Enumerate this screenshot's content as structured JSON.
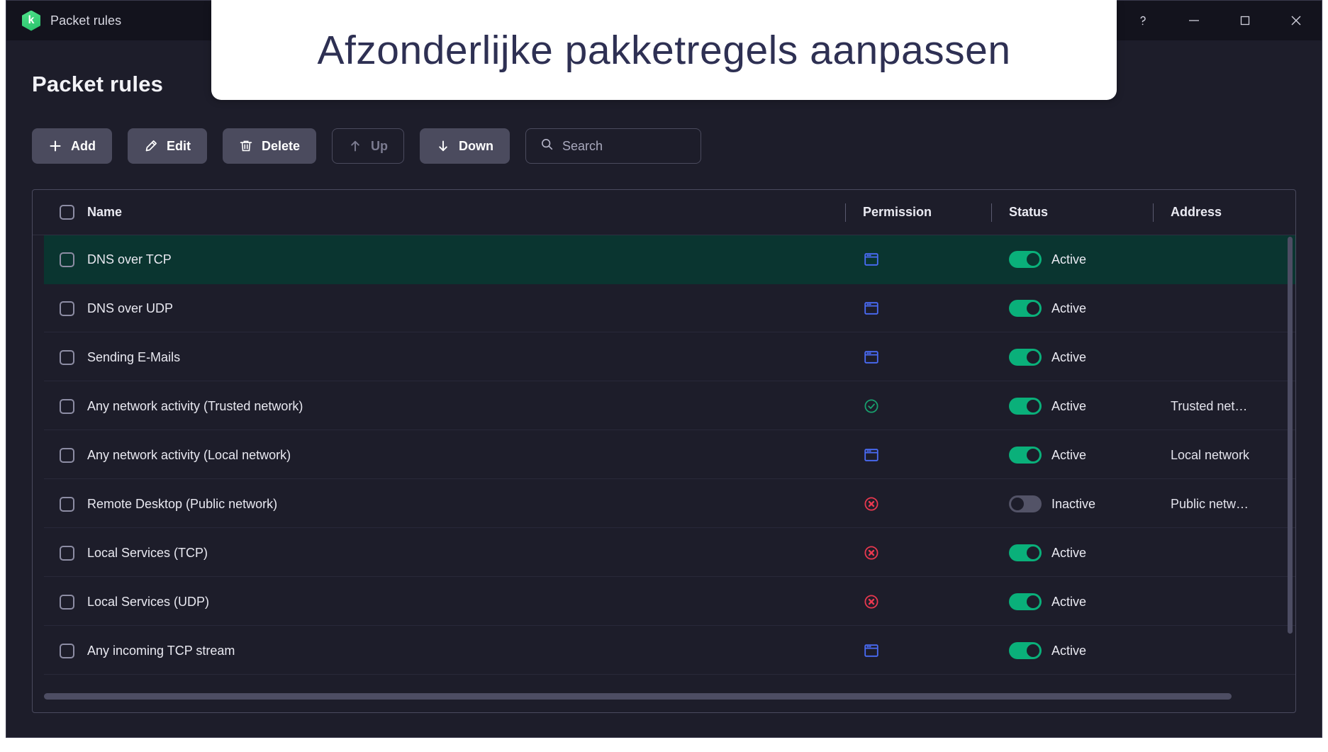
{
  "window": {
    "title": "Packet rules",
    "logo_icon": "kaspersky-hex-k-icon",
    "logo_letter": "k",
    "controls": [
      {
        "name": "help-button",
        "icon": "question-mark-icon",
        "label": "?"
      },
      {
        "name": "minimize-button",
        "icon": "minimize-icon",
        "label": "—"
      },
      {
        "name": "maximize-button",
        "icon": "maximize-icon",
        "label": "□"
      },
      {
        "name": "close-button",
        "icon": "close-icon",
        "label": "×"
      }
    ]
  },
  "page": {
    "title": "Packet rules"
  },
  "overlay": {
    "text": "Afzonderlijke pakketregels aanpassen",
    "text_color": "#2e3053",
    "background": "#ffffff"
  },
  "toolbar": {
    "add_label": "Add",
    "add_icon": "plus-icon",
    "edit_label": "Edit",
    "edit_icon": "pencil-icon",
    "delete_label": "Delete",
    "delete_icon": "trash-icon",
    "up_label": "Up",
    "up_icon": "arrow-up-icon",
    "up_disabled": true,
    "down_label": "Down",
    "down_icon": "arrow-down-icon",
    "down_disabled": false,
    "search_placeholder": "Search",
    "search_value": "",
    "search_icon": "magnifier-icon"
  },
  "table": {
    "columns": {
      "name": "Name",
      "permission": "Permission",
      "status": "Status",
      "address": "Address"
    },
    "select_all_checked": false,
    "rows": [
      {
        "name": "DNS over TCP",
        "permission": "ask",
        "status": "Active",
        "status_on": true,
        "address": "",
        "selected": true,
        "checked": false
      },
      {
        "name": "DNS over UDP",
        "permission": "ask",
        "status": "Active",
        "status_on": true,
        "address": "",
        "selected": false,
        "checked": false
      },
      {
        "name": "Sending E-Mails",
        "permission": "ask",
        "status": "Active",
        "status_on": true,
        "address": "",
        "selected": false,
        "checked": false
      },
      {
        "name": "Any network activity (Trusted network)",
        "permission": "allow",
        "status": "Active",
        "status_on": true,
        "address": "Trusted net…",
        "selected": false,
        "checked": false
      },
      {
        "name": "Any network activity (Local network)",
        "permission": "ask",
        "status": "Active",
        "status_on": true,
        "address": "Local network",
        "selected": false,
        "checked": false
      },
      {
        "name": "Remote Desktop (Public network)",
        "permission": "block",
        "status": "Inactive",
        "status_on": false,
        "address": "Public netw…",
        "selected": false,
        "checked": false
      },
      {
        "name": "Local Services (TCP)",
        "permission": "block",
        "status": "Active",
        "status_on": true,
        "address": "",
        "selected": false,
        "checked": false
      },
      {
        "name": "Local Services (UDP)",
        "permission": "block",
        "status": "Active",
        "status_on": true,
        "address": "",
        "selected": false,
        "checked": false
      },
      {
        "name": "Any incoming TCP stream",
        "permission": "ask",
        "status": "Active",
        "status_on": true,
        "address": "",
        "selected": false,
        "checked": false
      }
    ]
  },
  "colors": {
    "window_background": "#1d1d2a",
    "titlebar_background": "#13131d",
    "selected_row": "#0a3530",
    "toggle_on": "#0ab07a",
    "toggle_off": "#535367",
    "permission_ask": "#4a6cf7",
    "permission_allow": "#18a06e",
    "permission_block": "#e8384f",
    "button_background": "#4b4b5e",
    "text_primary": "#eaeaf2"
  }
}
